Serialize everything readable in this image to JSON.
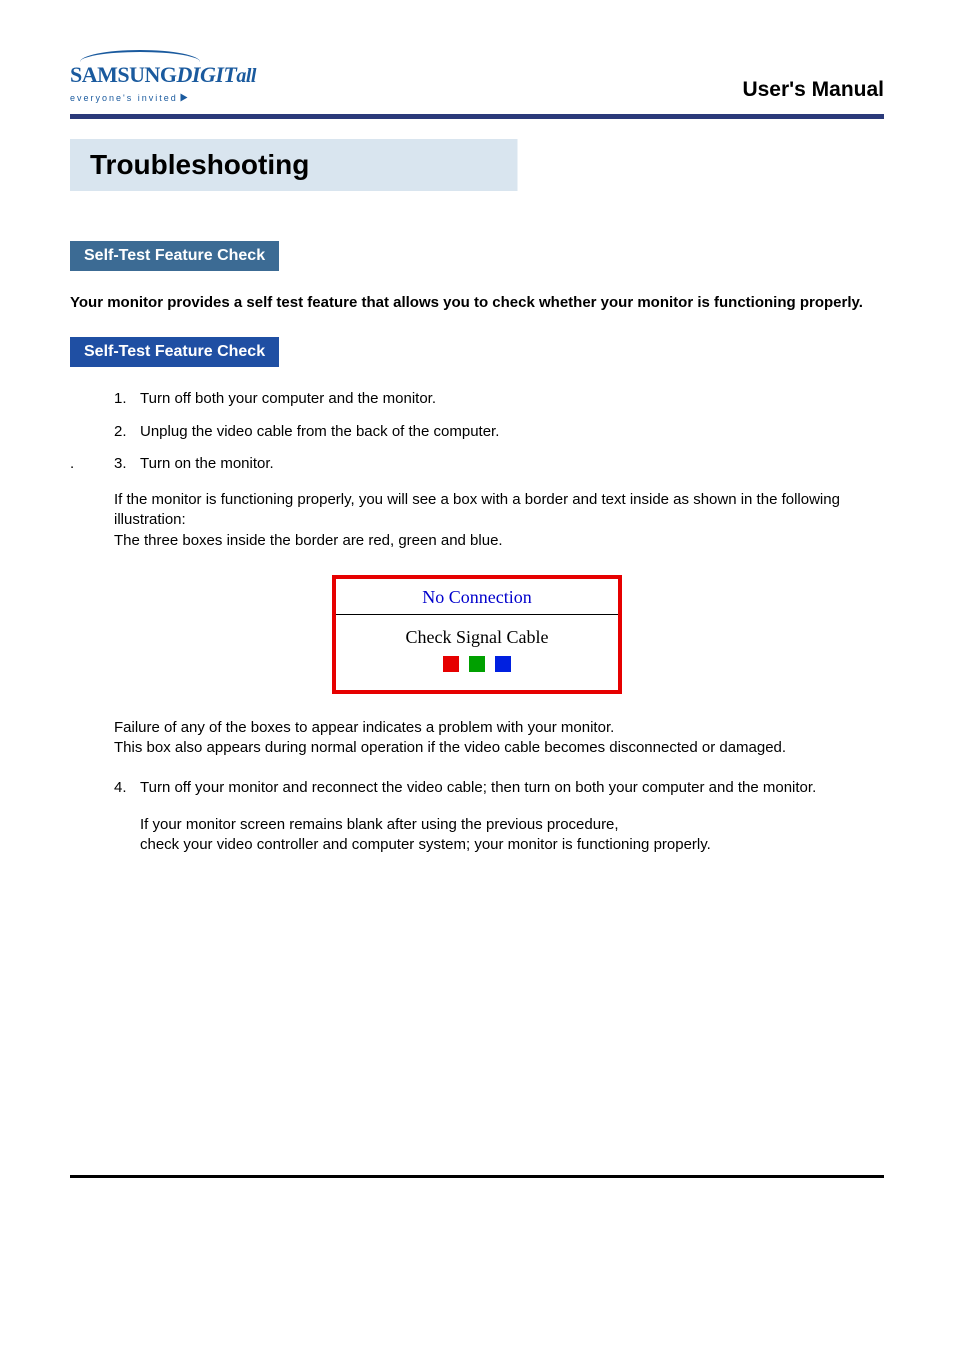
{
  "header": {
    "logo_brand": "SAMSUNG",
    "logo_suffix1": " DIGIT",
    "logo_suffix2": "all",
    "logo_tagline": "everyone's invited",
    "manual_label": "User's Manual"
  },
  "page": {
    "title": "Troubleshooting"
  },
  "section": {
    "heading": "Self-Test Feature Check",
    "intro": "Your monitor provides a self test feature that allows you to check whether your monitor is functioning properly.",
    "sub_heading": "Self-Test Feature Check"
  },
  "steps": {
    "s1": "Turn off both your computer and the monitor.",
    "s2": "Unplug the video cable from the back of the computer.",
    "s3": "Turn on the monitor.",
    "after3_a": "If the monitor is functioning properly, you will see a box with a border and  text inside as shown in the following illustration:",
    "after3_b": "The three boxes inside the border are red, green and blue.",
    "monitor_title": "No Connection",
    "monitor_sub": "Check Signal Cable",
    "fail_a": "Failure of any of the boxes to appear indicates a problem with your monitor.",
    "fail_b": "This box also appears during normal operation if the video cable becomes disconnected or damaged.",
    "s4": "Turn off your monitor and reconnect the video cable; then turn on both your computer and the monitor.",
    "after4_a": "If your monitor screen remains blank after using the previous procedure,",
    "after4_b": "check your video controller and computer system; your monitor is functioning properly."
  }
}
